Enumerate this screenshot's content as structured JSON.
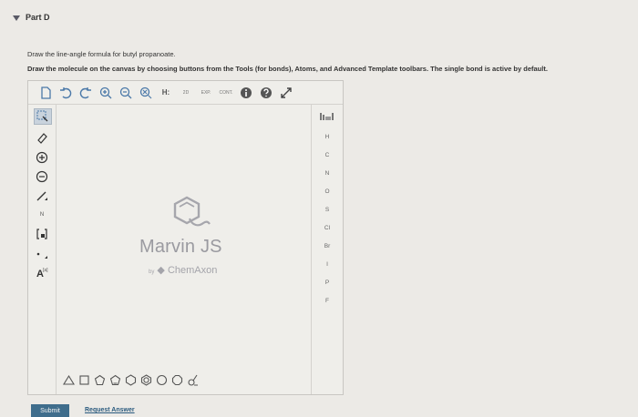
{
  "part": {
    "title": "Part D"
  },
  "question": {
    "line1": "Draw the line-angle formula for butyl propanoate.",
    "line2": "Draw the molecule on the canvas by choosing buttons from the Tools (for bonds), Atoms, and Advanced Template toolbars. The single bond is active by default."
  },
  "editor": {
    "top_toolbar": {
      "hydrogens_label": "H:",
      "twod_label": "2D",
      "exp_label": "EXP.",
      "cont_label": "CONT."
    },
    "left_toolbar": {
      "chain_label": "N",
      "bracket_label": "[ ]",
      "text_label": "A",
      "text_sub": "[a]"
    },
    "elements": [
      "H",
      "C",
      "N",
      "O",
      "S",
      "Cl",
      "Br",
      "I",
      "P",
      "F"
    ],
    "watermark": {
      "product": "Marvin JS",
      "by": "by",
      "company": "ChemAxon"
    }
  },
  "actions": {
    "submit_label": "Submit",
    "request_label": "Request Answer"
  }
}
